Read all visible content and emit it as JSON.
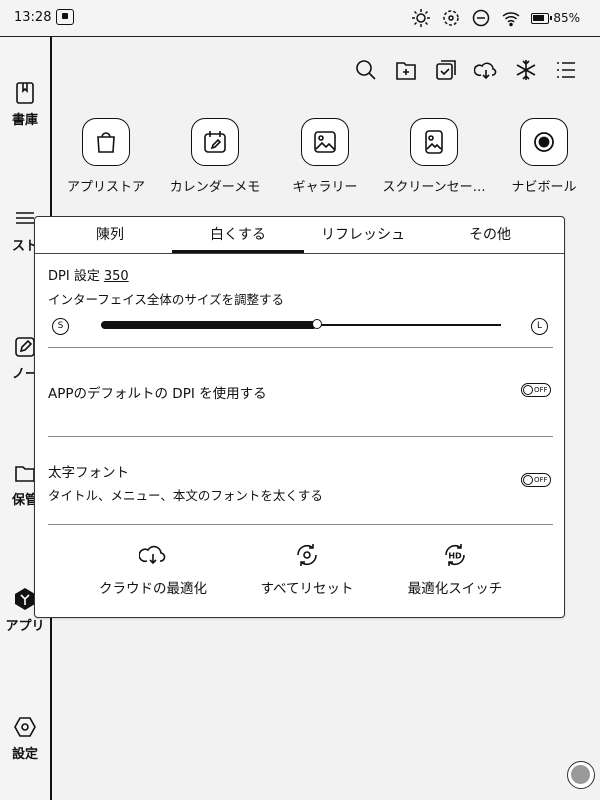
{
  "status": {
    "time": "13:28",
    "battery": "85%",
    "icons": [
      "screen-record-icon",
      "brightness-icon",
      "refresh-icon",
      "minus-circle-icon",
      "wifi-icon",
      "battery-icon"
    ]
  },
  "sidebar": {
    "items": [
      {
        "label": "書庫",
        "icon": "book-icon"
      },
      {
        "label": "スト",
        "icon": "store-icon"
      },
      {
        "label": "ノー",
        "icon": "note-icon"
      },
      {
        "label": "保管",
        "icon": "folder-icon"
      },
      {
        "label": "アプリ",
        "icon": "apps-icon"
      },
      {
        "label": "設定",
        "icon": "settings-hex-icon"
      }
    ]
  },
  "toolbar": {
    "icons": [
      "search-icon",
      "add-folder-icon",
      "multi-select-icon",
      "cloud-download-icon",
      "freeze-icon",
      "list-menu-icon"
    ]
  },
  "apps": [
    {
      "label": "アプリストア",
      "icon": "shopping-bag-icon"
    },
    {
      "label": "カレンダーメモ",
      "icon": "calendar-memo-icon"
    },
    {
      "label": "ギャラリー",
      "icon": "gallery-icon"
    },
    {
      "label": "スクリーンセー…",
      "icon": "screensaver-icon"
    },
    {
      "label": "ナビボール",
      "icon": "navi-ball-icon"
    }
  ],
  "panel": {
    "tabs": [
      "陳列",
      "白くする",
      "リフレッシュ",
      "その他"
    ],
    "active_tab": 0,
    "dpi": {
      "title": "DPI 設定",
      "value": "350",
      "subtitle": "インターフェイス全体のサイズを調整する",
      "min_label": "S",
      "max_label": "L",
      "level": 0.54
    },
    "app_dpi": {
      "title": "APPのデフォルトの DPI を使用する",
      "toggle": "OFF"
    },
    "bold_font": {
      "title": "太字フォント",
      "subtitle": "タイトル、メニュー、本文のフォントを太くする",
      "toggle": "OFF"
    },
    "actions": [
      {
        "label": "クラウドの最適化",
        "icon": "cloud-optimize-icon"
      },
      {
        "label": "すべてリセット",
        "icon": "reset-all-icon"
      },
      {
        "label": "最適化スイッチ",
        "icon": "hd-switch-icon"
      }
    ]
  },
  "colors": {
    "ink": "#111111",
    "background": "#f2f2f2",
    "panel": "#ffffff"
  }
}
